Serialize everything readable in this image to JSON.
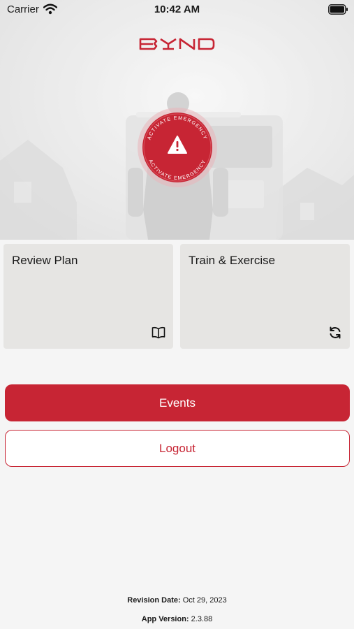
{
  "status_bar": {
    "carrier": "Carrier",
    "time": "10:42 AM",
    "wifi_icon": "wifi-icon",
    "battery_icon": "battery-icon"
  },
  "hero": {
    "logo_text": "BYND",
    "activate_label": "ACTIVATE EMERGENCY",
    "warning_icon": "warning-triangle-icon"
  },
  "tiles": [
    {
      "label": "Review Plan",
      "icon": "book-icon"
    },
    {
      "label": "Train & Exercise",
      "icon": "refresh-icon"
    }
  ],
  "buttons": {
    "events": "Events",
    "logout": "Logout"
  },
  "footer": {
    "revision_label": "Revision Date:",
    "revision_value": "Oct 29, 2023",
    "version_label": "App Version:",
    "version_value": "2.3.88"
  },
  "colors": {
    "brand_red": "#c72534",
    "tile_bg": "#e6e5e3",
    "page_bg": "#f5f5f5"
  }
}
